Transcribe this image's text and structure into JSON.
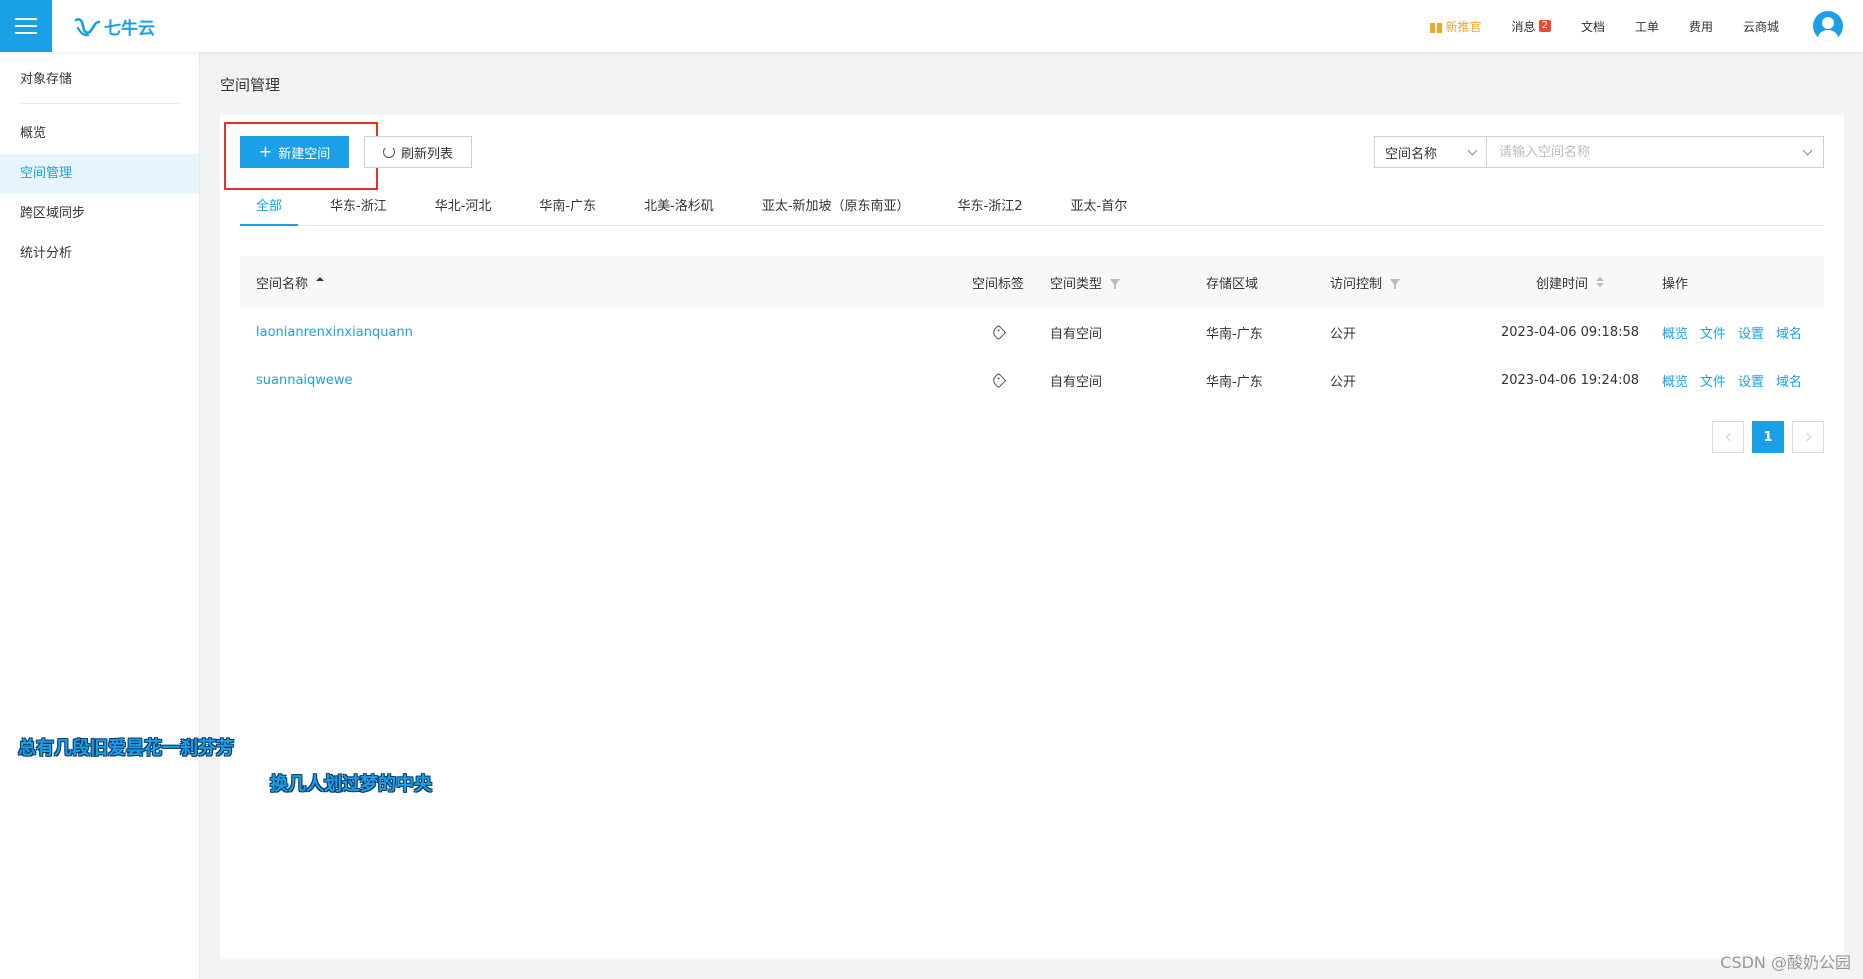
{
  "topbar": {
    "brand": "七牛云",
    "nav": [
      {
        "label": "新推官",
        "promo": true
      },
      {
        "label": "消息",
        "badge": "2"
      },
      {
        "label": "文档"
      },
      {
        "label": "工单"
      },
      {
        "label": "费用"
      },
      {
        "label": "云商城"
      }
    ],
    "accent_color": "#1aa0e6"
  },
  "sidebar": {
    "title": "对象存储",
    "items": [
      {
        "label": "概览",
        "active": false
      },
      {
        "label": "空间管理",
        "active": true
      },
      {
        "label": "跨区域同步",
        "active": false
      },
      {
        "label": "统计分析",
        "active": false
      }
    ]
  },
  "page": {
    "title": "空间管理"
  },
  "toolbar": {
    "new_label": "新建空间",
    "refresh_label": "刷新列表",
    "search_field": "空间名称",
    "search_placeholder": "请输入空间名称"
  },
  "tabs": [
    {
      "label": "全部",
      "active": true
    },
    {
      "label": "华东-浙江"
    },
    {
      "label": "华北-河北"
    },
    {
      "label": "华南-广东"
    },
    {
      "label": "北美-洛杉矶"
    },
    {
      "label": "亚太-新加坡（原东南亚）"
    },
    {
      "label": "华东-浙江2"
    },
    {
      "label": "亚太-首尔"
    }
  ],
  "table": {
    "headers": {
      "name": "空间名称",
      "tag": "空间标签",
      "type": "空间类型",
      "region": "存储区域",
      "acl": "访问控制",
      "created": "创建时间",
      "ops": "操作"
    },
    "rows": [
      {
        "name": "laonianrenxinxianquann",
        "type": "自有空间",
        "region": "华南-广东",
        "acl": "公开",
        "created": "2023-04-06 09:18:58"
      },
      {
        "name": "suannaiqwewe",
        "type": "自有空间",
        "region": "华南-广东",
        "acl": "公开",
        "created": "2023-04-06 19:24:08"
      }
    ],
    "ops": [
      "概览",
      "文件",
      "设置",
      "域名"
    ]
  },
  "pagination": {
    "current": "1"
  },
  "overlay": {
    "lyric1": "总有几段旧爱昙花一刹芬芳",
    "lyric2": "换几人划过梦的中央",
    "watermark": "CSDN @酸奶公园"
  }
}
